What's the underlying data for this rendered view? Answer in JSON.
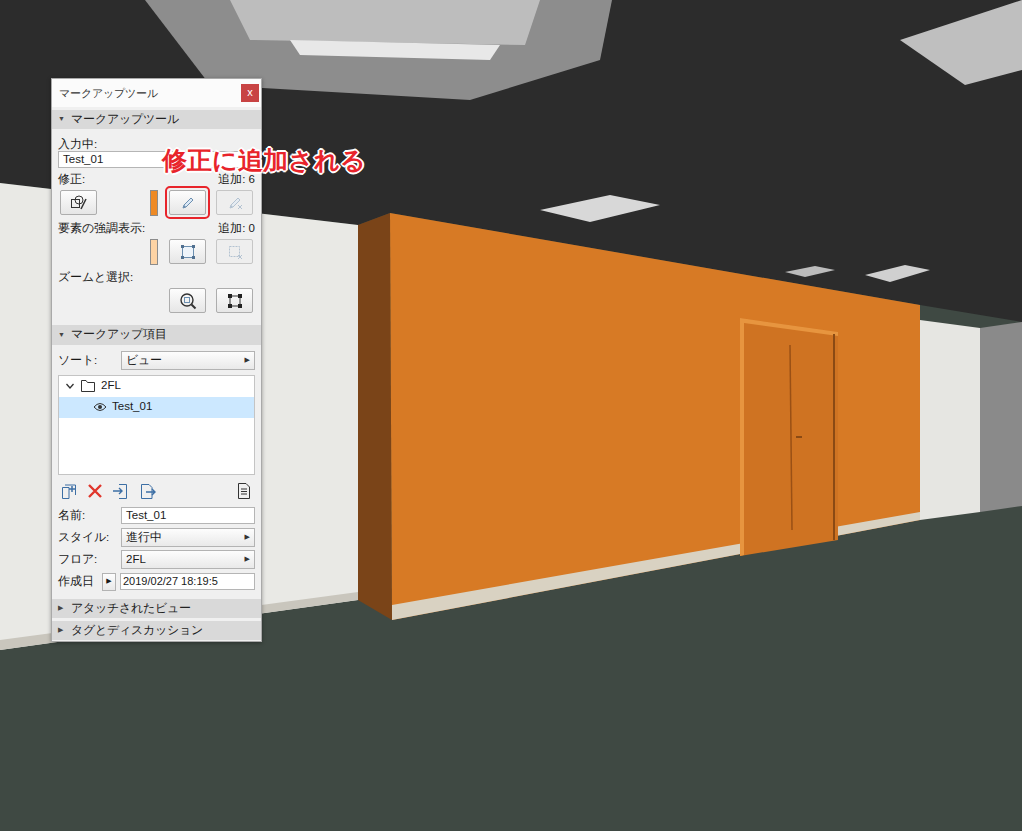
{
  "palette": {
    "title": "マークアップツール",
    "close": "x"
  },
  "annotation": "修正に追加される",
  "tool_section": {
    "toggle": "▼",
    "label": "マークアップツール",
    "expanded": true
  },
  "entry": {
    "label": "入力中:",
    "value": "Test_01"
  },
  "correction": {
    "label": "修正:",
    "count": "追加: 6",
    "color": "#ee8a25",
    "buttons": [
      {
        "kind": "shape-pen",
        "disabled": false,
        "annotated": false
      },
      {
        "kind": "add",
        "disabled": false,
        "annotated": true
      },
      {
        "kind": "remove",
        "disabled": true,
        "annotated": false
      }
    ]
  },
  "highlight": {
    "label": "要素の強調表示:",
    "count": "追加: 0",
    "color": "#fdd3a4",
    "buttons": [
      {
        "kind": "add-rect",
        "disabled": false,
        "annotated": false
      },
      {
        "kind": "remove-rect",
        "disabled": true,
        "annotated": false
      }
    ]
  },
  "zoom": {
    "label": "ズームと選択:",
    "buttons": [
      {
        "kind": "zoom",
        "disabled": false,
        "annotated": false
      },
      {
        "kind": "select",
        "disabled": false,
        "annotated": false
      }
    ]
  },
  "items_section": {
    "toggle": "▼",
    "label": "マークアップ項目",
    "expanded": true
  },
  "sort": {
    "label": "ソート:",
    "value": "ビュー",
    "arrow": "▶"
  },
  "tree": [
    {
      "kind": "folder",
      "label": "2FL",
      "expanded": true,
      "selected": false
    },
    {
      "kind": "entry",
      "label": "Test_01",
      "visible": true,
      "selected": true
    }
  ],
  "toolbar": [
    {
      "kind": "new"
    },
    {
      "kind": "delete"
    },
    {
      "kind": "import"
    },
    {
      "kind": "export"
    },
    {
      "kind": "report"
    }
  ],
  "fields": [
    {
      "kind": "input",
      "label": "名前:",
      "value": "Test_01"
    },
    {
      "kind": "select",
      "label": "スタイル:",
      "value": "進行中",
      "arrow": "▶"
    },
    {
      "kind": "select",
      "label": "フロア:",
      "value": "2FL",
      "arrow": "▶"
    },
    {
      "kind": "date",
      "label": "作成日",
      "value": "2019/02/27 18:19:5",
      "arrow": "▶"
    }
  ],
  "collapsed_sections": [
    {
      "toggle": "▶",
      "label": "アタッチされたビュー",
      "expanded": false
    },
    {
      "toggle": "▶",
      "label": "タグとディスカッション",
      "expanded": false
    }
  ]
}
